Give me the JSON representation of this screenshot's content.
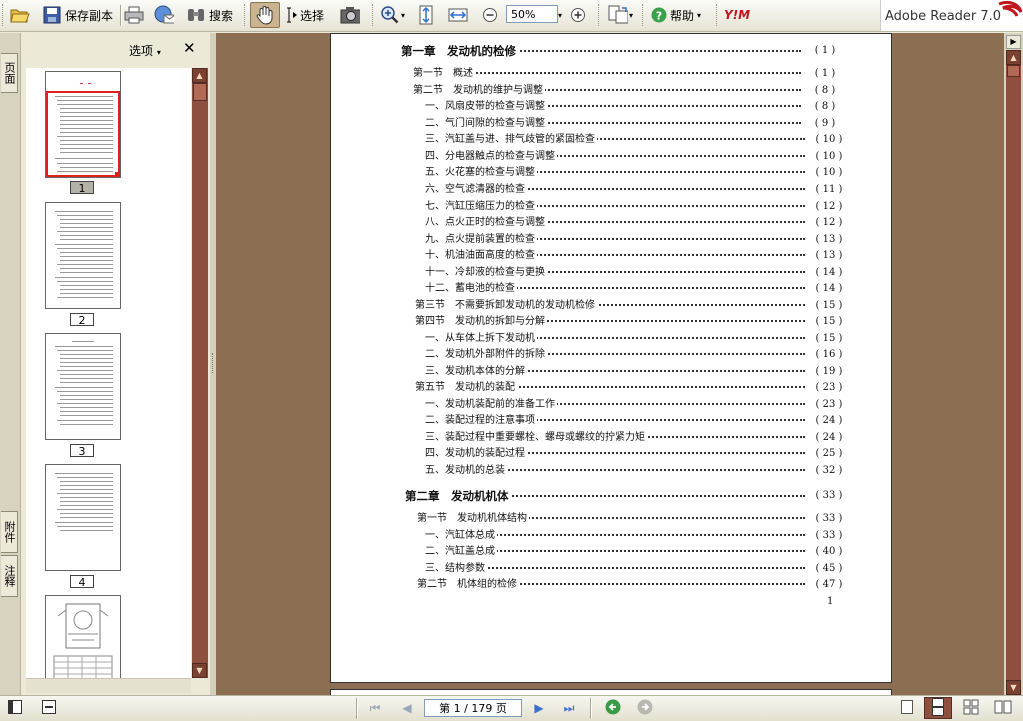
{
  "toolbar": {
    "save_copy": "保存副本",
    "search": "搜索",
    "select": "选择",
    "zoom_value": "50%",
    "help": "帮助",
    "brand_text": "Adobe Reader 7.0",
    "brand_logo": "Y!M"
  },
  "left_tabs": {
    "pages": "页面",
    "attachments": "附件",
    "comments": "注释"
  },
  "panel": {
    "options_label": "选项",
    "thumbnails": [
      {
        "label": "1"
      },
      {
        "label": "2"
      },
      {
        "label": "3"
      },
      {
        "label": "4"
      }
    ]
  },
  "document": {
    "toc": [
      {
        "text": "第一章　发动机的检修",
        "page": "( 1 )",
        "kind": "chapter"
      },
      {
        "text": "第一节　概述",
        "page": "( 1 )",
        "kind": "section"
      },
      {
        "text": "第二节　发动机的维护与调整",
        "page": "( 8 )",
        "kind": "section"
      },
      {
        "text": "一、风扇皮带的检查与调整",
        "page": "( 8 )",
        "kind": "item"
      },
      {
        "text": "二、气门间隙的检查与调整",
        "page": "( 9 )",
        "kind": "item"
      },
      {
        "text": "三、汽缸盖与进、排气歧管的紧固检查",
        "page": "( 10 )",
        "kind": "item"
      },
      {
        "text": "四、分电器触点的检查与调整",
        "page": "( 10 )",
        "kind": "item"
      },
      {
        "text": "五、火花塞的检查与调整",
        "page": "( 10 )",
        "kind": "item"
      },
      {
        "text": "六、空气滤清器的检查",
        "page": "( 11 )",
        "kind": "item"
      },
      {
        "text": "七、汽缸压缩压力的检查",
        "page": "( 12 )",
        "kind": "item"
      },
      {
        "text": "八、点火正时的检查与调整",
        "page": "( 12 )",
        "kind": "item"
      },
      {
        "text": "九、点火提前装置的检查",
        "page": "( 13 )",
        "kind": "item"
      },
      {
        "text": "十、机油油面高度的检查",
        "page": "( 13 )",
        "kind": "item"
      },
      {
        "text": "十一、冷却液的检查与更换",
        "page": "( 14 )",
        "kind": "item"
      },
      {
        "text": "十二、蓄电池的检查",
        "page": "( 14 )",
        "kind": "item"
      },
      {
        "text": "第三节　不需要拆卸发动机的发动机检修",
        "page": "( 15 )",
        "kind": "section"
      },
      {
        "text": "第四节　发动机的拆卸与分解",
        "page": "( 15 )",
        "kind": "section"
      },
      {
        "text": "一、从车体上拆下发动机",
        "page": "( 15 )",
        "kind": "item"
      },
      {
        "text": "二、发动机外部附件的拆除",
        "page": "( 16 )",
        "kind": "item"
      },
      {
        "text": "三、发动机本体的分解",
        "page": "( 19 )",
        "kind": "item"
      },
      {
        "text": "第五节　发动机的装配",
        "page": "( 23 )",
        "kind": "section"
      },
      {
        "text": "一、发动机装配前的准备工作",
        "page": "( 23 )",
        "kind": "item"
      },
      {
        "text": "二、装配过程的注意事项",
        "page": "( 24 )",
        "kind": "item"
      },
      {
        "text": "三、装配过程中重要螺栓、螺母或螺纹的拧紧力矩",
        "page": "( 24 )",
        "kind": "item"
      },
      {
        "text": "四、发动机的装配过程",
        "page": "( 25 )",
        "kind": "item"
      },
      {
        "text": "五、发动机的总装",
        "page": "( 32 )",
        "kind": "item"
      },
      {
        "text": "第二章　发动机机体",
        "page": "( 33 )",
        "kind": "chapter"
      },
      {
        "text": "第一节　发动机机体结构",
        "page": "( 33 )",
        "kind": "section"
      },
      {
        "text": "一、汽缸体总成",
        "page": "( 33 )",
        "kind": "item"
      },
      {
        "text": "二、汽缸盖总成",
        "page": "( 40 )",
        "kind": "item"
      },
      {
        "text": "三、结构参数",
        "page": "( 45 )",
        "kind": "item"
      },
      {
        "text": "第二节　机体组的检修",
        "page": "( 47 )",
        "kind": "section"
      }
    ],
    "page_number": "1"
  },
  "statusbar": {
    "page_field": "第 1 / 179 页"
  },
  "colors": {
    "doc_background": "#8c6f53",
    "scrollbar": "#8e4f3e",
    "brand_red": "#c0161d"
  }
}
